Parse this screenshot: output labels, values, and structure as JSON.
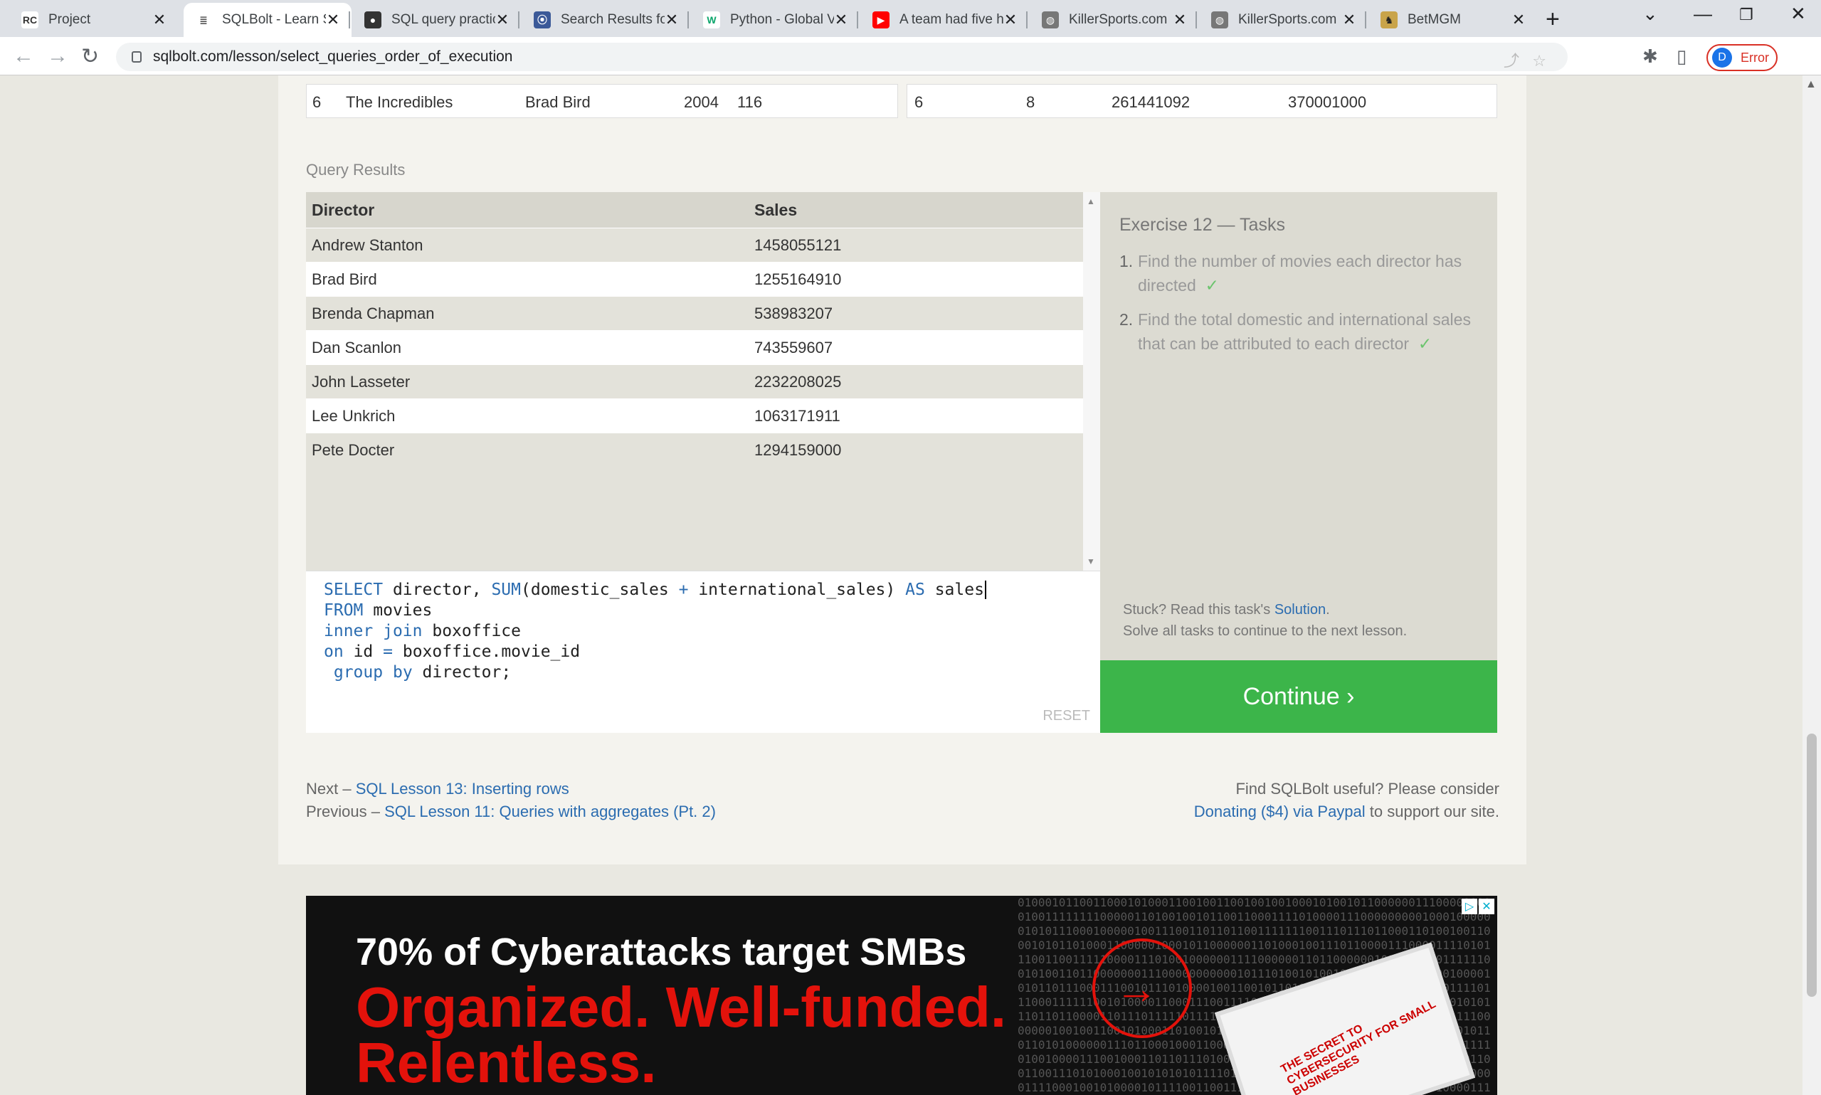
{
  "browser": {
    "tabs": [
      {
        "label": "Project",
        "favicon": "RC"
      },
      {
        "label": "SQLBolt - Learn SQ",
        "favicon": "db"
      },
      {
        "label": "SQL query practic",
        "favicon": "gh"
      },
      {
        "label": "Search Results for",
        "favicon": "sr"
      },
      {
        "label": "Python - Global V",
        "favicon": "W"
      },
      {
        "label": "A team had five h",
        "favicon": "yt"
      },
      {
        "label": "KillerSports.com",
        "favicon": "globe"
      },
      {
        "label": "KillerSports.com",
        "favicon": "globe"
      },
      {
        "label": "BetMGM",
        "favicon": "bm"
      }
    ],
    "url": "sqlbolt.com/lesson/select_queries_order_of_execution",
    "profile_initial": "D",
    "profile_status": "Error"
  },
  "top_table": {
    "left_row": {
      "id": "6",
      "title": "The Incredibles",
      "director": "Brad Bird",
      "year": "2004",
      "length": "116"
    },
    "right_row": {
      "id": "6",
      "rating": "8",
      "domestic": "261441092",
      "international": "370001000"
    }
  },
  "query_results": {
    "label": "Query Results",
    "columns": [
      "Director",
      "Sales"
    ],
    "rows": [
      [
        "Andrew Stanton",
        "1458055121"
      ],
      [
        "Brad Bird",
        "1255164910"
      ],
      [
        "Brenda Chapman",
        "538983207"
      ],
      [
        "Dan Scanlon",
        "743559607"
      ],
      [
        "John Lasseter",
        "2232208025"
      ],
      [
        "Lee Unkrich",
        "1063171911"
      ],
      [
        "Pete Docter",
        "1294159000"
      ]
    ]
  },
  "editor": {
    "lines": [
      "SELECT director, SUM(domestic_sales + international_sales) AS sales",
      "FROM movies",
      "inner join boxoffice",
      "on id = boxoffice.movie_id",
      " group by director;"
    ],
    "reset_label": "RESET"
  },
  "tasks": {
    "title": "Exercise 12 — Tasks",
    "items": [
      {
        "num": "1.",
        "text": "Find the number of movies each director has directed",
        "check": "✓"
      },
      {
        "num": "2.",
        "text": "Find the total domestic and international sales that can be attributed to each director",
        "check": "✓"
      }
    ],
    "stuck_prefix": "Stuck? Read this task's ",
    "solution_link": "Solution",
    "stuck_suffix": ".",
    "solve_all": "Solve all tasks to continue to the next lesson.",
    "continue_label": "Continue ›"
  },
  "footer": {
    "next_prefix": "Next – ",
    "next_link": "SQL Lesson 13: Inserting rows",
    "prev_prefix": "Previous – ",
    "prev_link": "SQL Lesson 11: Queries with aggregates (Pt. 2)",
    "useful": "Find SQLBolt useful? Please consider",
    "donate_link": "Donating ($4) via Paypal",
    "donate_suffix": " to support our site."
  },
  "ad": {
    "headline": "70% of Cyberattacks target SMBs",
    "tagline_1": "Organized. Well-funded.",
    "tagline_2": "Relentless.",
    "book_title": "THE SECRET TO CYBERSECURITY FOR SMALL BUSINESSES"
  }
}
